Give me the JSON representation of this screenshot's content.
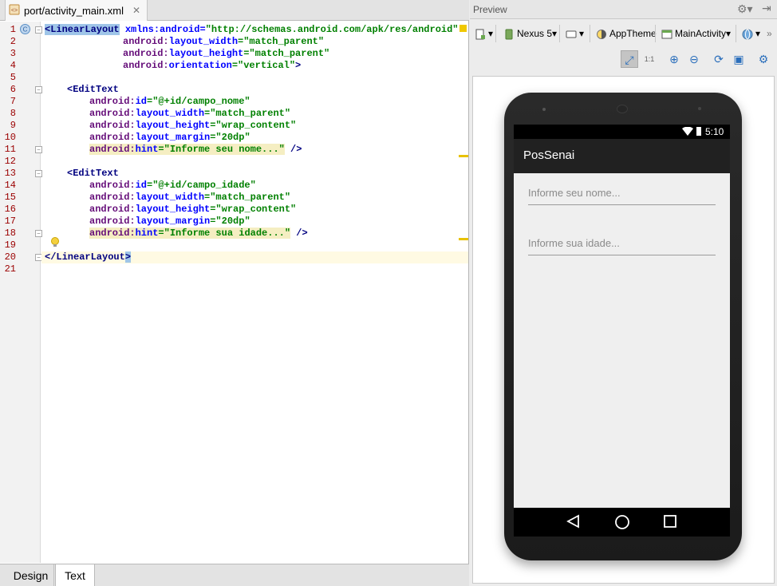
{
  "editor": {
    "tab_label": "port/activity_main.xml",
    "tab_close": "✕",
    "line_numbers": [
      "1",
      "2",
      "3",
      "4",
      "5",
      "6",
      "7",
      "8",
      "9",
      "10",
      "11",
      "12",
      "13",
      "14",
      "15",
      "16",
      "17",
      "18",
      "19",
      "20",
      "21"
    ],
    "code": {
      "l1_open": "<LinearLayout",
      "l1_attr": "xmlns:android",
      "l1_eq": "=",
      "l1_val": "\"http://schemas.android.com/apk/res/android\"",
      "l2_ns": "android:",
      "l2_attr": "layout_width",
      "l2_val": "=\"match_parent\"",
      "l3_ns": "android:",
      "l3_attr": "layout_height",
      "l3_val": "=\"match_parent\"",
      "l4_ns": "android:",
      "l4_attr": "orientation",
      "l4_val": "=\"vertical\"",
      "l4_close": ">",
      "l6_open": "<EditText",
      "l7_ns": "android:",
      "l7_attr": "id",
      "l7_val": "=\"@+id/campo_nome\"",
      "l8_ns": "android:",
      "l8_attr": "layout_width",
      "l8_val": "=\"match_parent\"",
      "l9_ns": "android:",
      "l9_attr": "layout_height",
      "l9_val": "=\"wrap_content\"",
      "l10_ns": "android:",
      "l10_attr": "layout_margin",
      "l10_val": "=\"20dp\"",
      "l11_ns": "android:",
      "l11_attr": "hint",
      "l11_val": "=\"Informe seu nome...\"",
      "l11_close": " />",
      "l13_open": "<EditText",
      "l14_ns": "android:",
      "l14_attr": "id",
      "l14_val": "=\"@+id/campo_idade\"",
      "l15_ns": "android:",
      "l15_attr": "layout_width",
      "l15_val": "=\"match_parent\"",
      "l16_ns": "android:",
      "l16_attr": "layout_height",
      "l16_val": "=\"wrap_content\"",
      "l17_ns": "android:",
      "l17_attr": "layout_margin",
      "l17_val": "=\"20dp\"",
      "l18_ns": "android:",
      "l18_attr": "hint",
      "l18_val": "=\"Informe sua idade...\"",
      "l18_close": " />",
      "l20_open": "</LinearLayout",
      "l20_close": ">"
    },
    "bottom_tabs": {
      "design": "Design",
      "text": "Text",
      "active": "Text"
    }
  },
  "preview": {
    "title": "Preview",
    "toolbar": {
      "device": "Nexus 5",
      "theme": "AppTheme",
      "activity": "MainActivity"
    },
    "phone": {
      "time": "5:10",
      "app_title": "PosSenai",
      "field1_hint": "Informe seu nome...",
      "field2_hint": "Informe sua idade..."
    }
  },
  "colors": {
    "xml_tag": "#000080",
    "xml_attr": "#660e7a",
    "xml_value": "#008000",
    "line_number": "#9b0000",
    "app_bar": "#212121"
  }
}
